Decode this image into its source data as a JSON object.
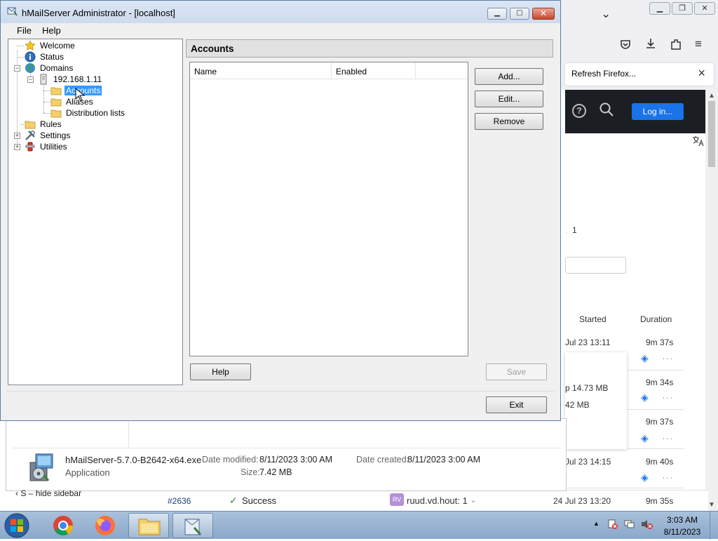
{
  "browser": {
    "tab_title": "Refresh Firefox...",
    "login_button": "Log in...",
    "fragment_one": "1",
    "col_started": "Started",
    "col_duration": "Duration",
    "rows": [
      {
        "started": "Jul 23 13:11",
        "duration": "9m 37s"
      },
      {
        "started": "",
        "duration": "9m 34s"
      },
      {
        "started": "",
        "duration": "9m 37s"
      },
      {
        "started": "Jul 23 14:15",
        "duration": "9m 40s"
      },
      {
        "started": "24 Jul 23 13:20",
        "duration": "9m 35s"
      }
    ],
    "popup_line1": "p  14.73 MB",
    "popup_line2": "42 MB",
    "build_number": "#2636",
    "build_status": "Success",
    "avatar_initials": "RV",
    "build_user": "ruud.vd.hout: 1",
    "hide_sidebar": "S – hide sidebar"
  },
  "explorer": {
    "file_name": "hMailServer-5.7.0-B2642-x64.exe",
    "file_type": "Application",
    "date_modified_label": "Date modified:",
    "date_modified": "8/11/2023 3:00 AM",
    "date_created_label": "Date created:",
    "date_created": "8/11/2023 3:00 AM",
    "size_label": "Size:",
    "size": "7.42 MB"
  },
  "window": {
    "title": "hMailServer Administrator - [localhost]",
    "menu": [
      "File",
      "Help"
    ],
    "tree": {
      "welcome": "Welcome",
      "status": "Status",
      "domains": "Domains",
      "domain": "192.168.1.11",
      "accounts": "Accounts",
      "aliases": "Aliases",
      "distribution_lists": "Distribution lists",
      "rules": "Rules",
      "settings": "Settings",
      "utilities": "Utilities"
    },
    "panel_title": "Accounts",
    "columns": [
      "Name",
      "Enabled"
    ],
    "buttons": {
      "add": "Add...",
      "edit": "Edit...",
      "remove": "Remove",
      "help": "Help",
      "save": "Save",
      "exit": "Exit"
    }
  },
  "taskbar": {
    "time": "3:03 AM",
    "date": "8/11/2023",
    "pinned": [
      "start-orb",
      "chrome",
      "firefox",
      "file-explorer",
      "hmailserver-admin"
    ]
  }
}
